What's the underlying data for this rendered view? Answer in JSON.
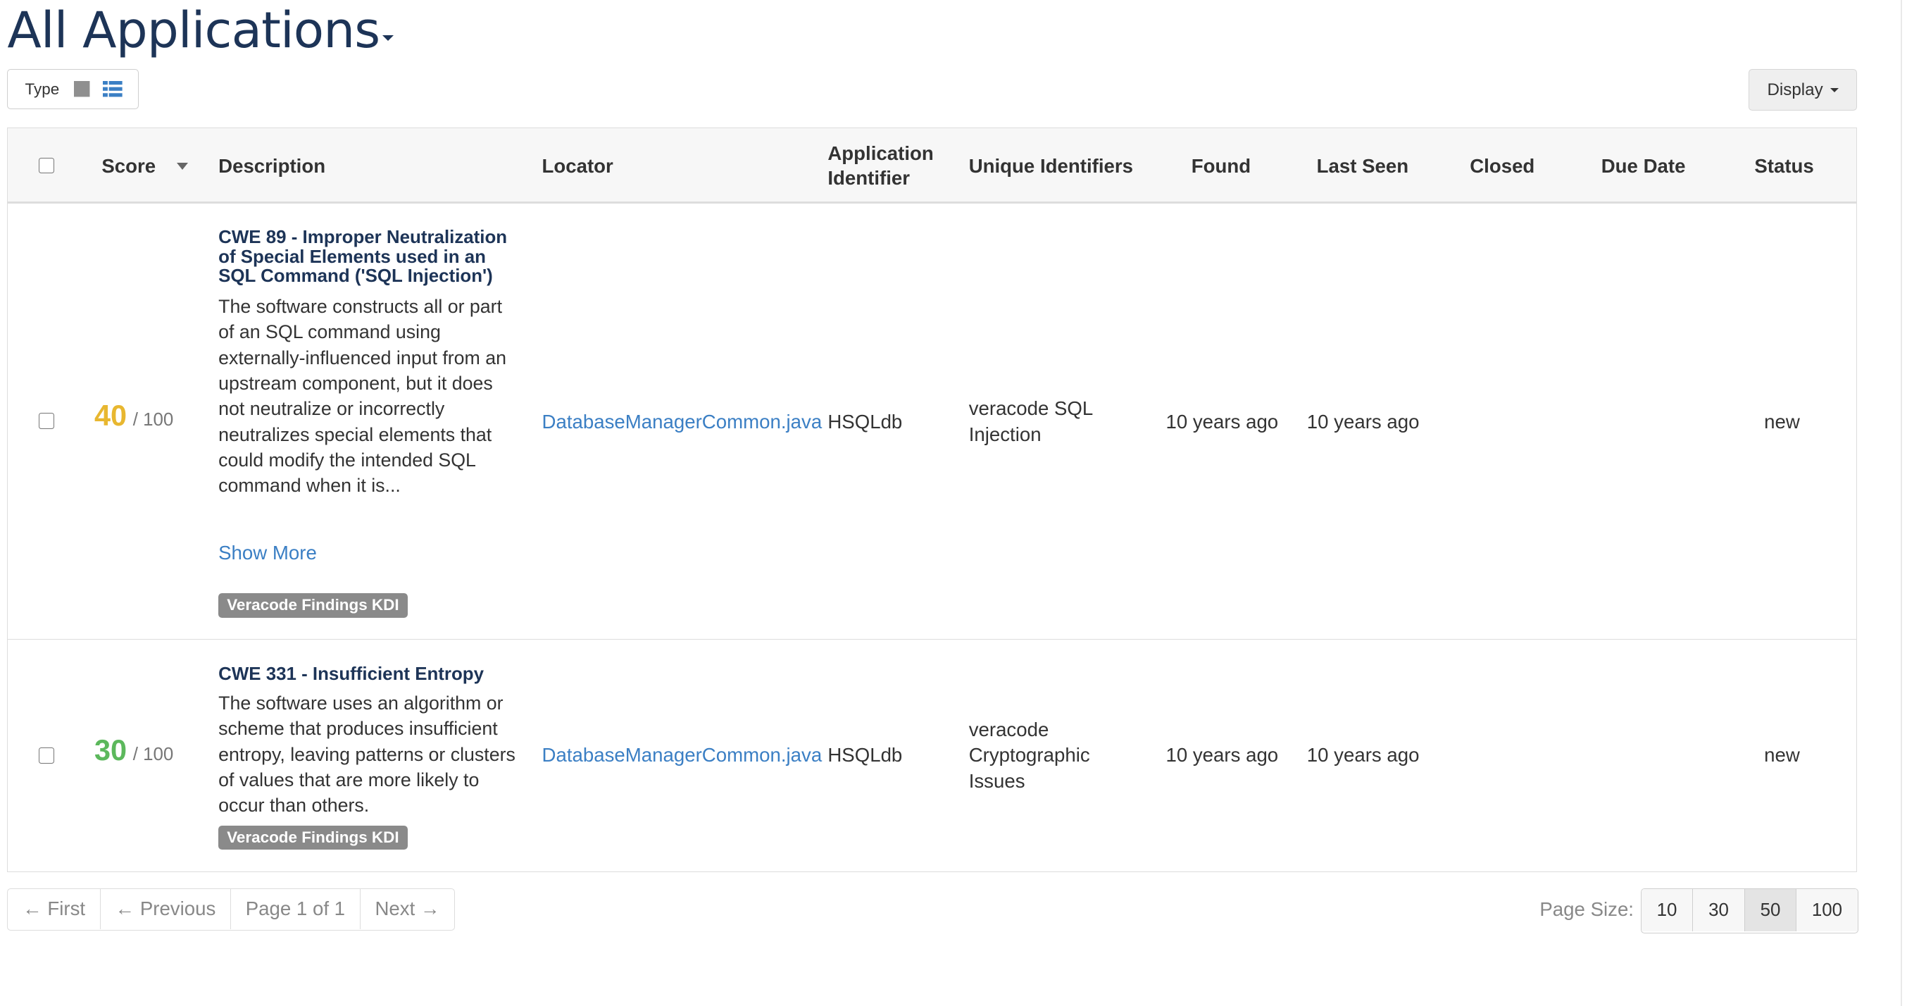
{
  "header": {
    "title": "All Applications"
  },
  "type_toggle": {
    "label": "Type"
  },
  "display_button": {
    "label": "Display"
  },
  "table": {
    "columns": [
      "Score",
      "Description",
      "Locator",
      "Application Identifier",
      "Unique Identifiers",
      "Found",
      "Last Seen",
      "Closed",
      "Due Date",
      "Status"
    ],
    "rows": [
      {
        "score": "40",
        "score_max": "/ 100",
        "score_color": "#e8b730",
        "title": "CWE 89 - Improper Neutralization of Special Elements used in an SQL Command ('SQL Injection')",
        "description": "The software constructs all or part of an SQL command using externally-influenced input from an upstream component, but it does not neutralize or incorrectly neutralizes special elements that could modify the intended SQL command when it is...",
        "show_more": "Show More",
        "tag": "Veracode Findings KDI",
        "locator": "DatabaseManagerCommon.java",
        "app_identifier": "HSQLdb",
        "unique_identifiers": "veracode SQL Injection",
        "found": "10 years ago",
        "last_seen": "10 years ago",
        "closed": "",
        "due_date": "",
        "status": "new"
      },
      {
        "score": "30",
        "score_max": "/ 100",
        "score_color": "#5cb85c",
        "title": "CWE 331 - Insufficient Entropy",
        "description": "The software uses an algorithm or scheme that produces insufficient entropy, leaving patterns or clusters of values that are more likely to occur than others.",
        "tag": "Veracode Findings KDI",
        "locator": "DatabaseManagerCommon.java",
        "app_identifier": "HSQLdb",
        "unique_identifiers": "veracode Cryptographic Issues",
        "found": "10 years ago",
        "last_seen": "10 years ago",
        "closed": "",
        "due_date": "",
        "status": "new"
      }
    ]
  },
  "pagination": {
    "first": "← First",
    "previous": "← Previous",
    "page_info": "Page 1 of 1",
    "next": "Next →",
    "page_size_label": "Page Size:",
    "page_sizes": [
      "10",
      "30",
      "50",
      "100"
    ],
    "selected_page_size": "50"
  },
  "icons": {
    "type_tile": "square-tile-icon",
    "type_list": "list-view-icon",
    "sort": "sort-caret-icon"
  },
  "colors": {
    "title": "#1d3457",
    "link": "#3b7fc4",
    "tag_bg": "#8a8a8a"
  }
}
